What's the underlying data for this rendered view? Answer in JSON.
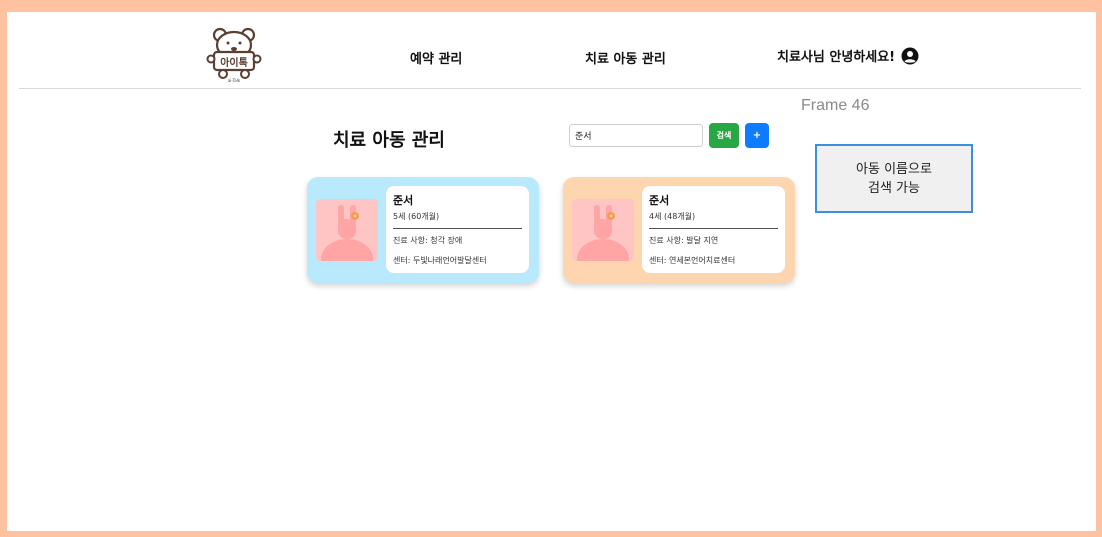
{
  "header": {
    "logo_text": "아이톡",
    "logo_subtext": "ai-Talk",
    "nav": {
      "reservation": "예약 관리",
      "children": "치료 아동 관리"
    },
    "greeting": "치료사님 안녕하세요!"
  },
  "frame_label": "Frame 46",
  "page": {
    "title": "치료 아동 관리",
    "search": {
      "value": "준서",
      "button_label": "검색",
      "add_label": "+"
    },
    "tooltip": "아동 이름으로\n검색 가능"
  },
  "children": [
    {
      "name": "준서",
      "age": "5세 (60개월)",
      "diagnosis": "진료 사항: 청각 장애",
      "center": "센터: 두빛나래언어발달센터"
    },
    {
      "name": "준서",
      "age": "4세 (48개월)",
      "diagnosis": "진료 사항: 발달 지연",
      "center": "센터: 연세본언어치료센터"
    }
  ],
  "colors": {
    "background": "#ffc2a1",
    "search_button": "#28a745",
    "add_button": "#0d7cff",
    "card_1": "#b8e9fc",
    "card_2": "#fdd5ae",
    "tooltip_border": "#3b8fe0"
  }
}
